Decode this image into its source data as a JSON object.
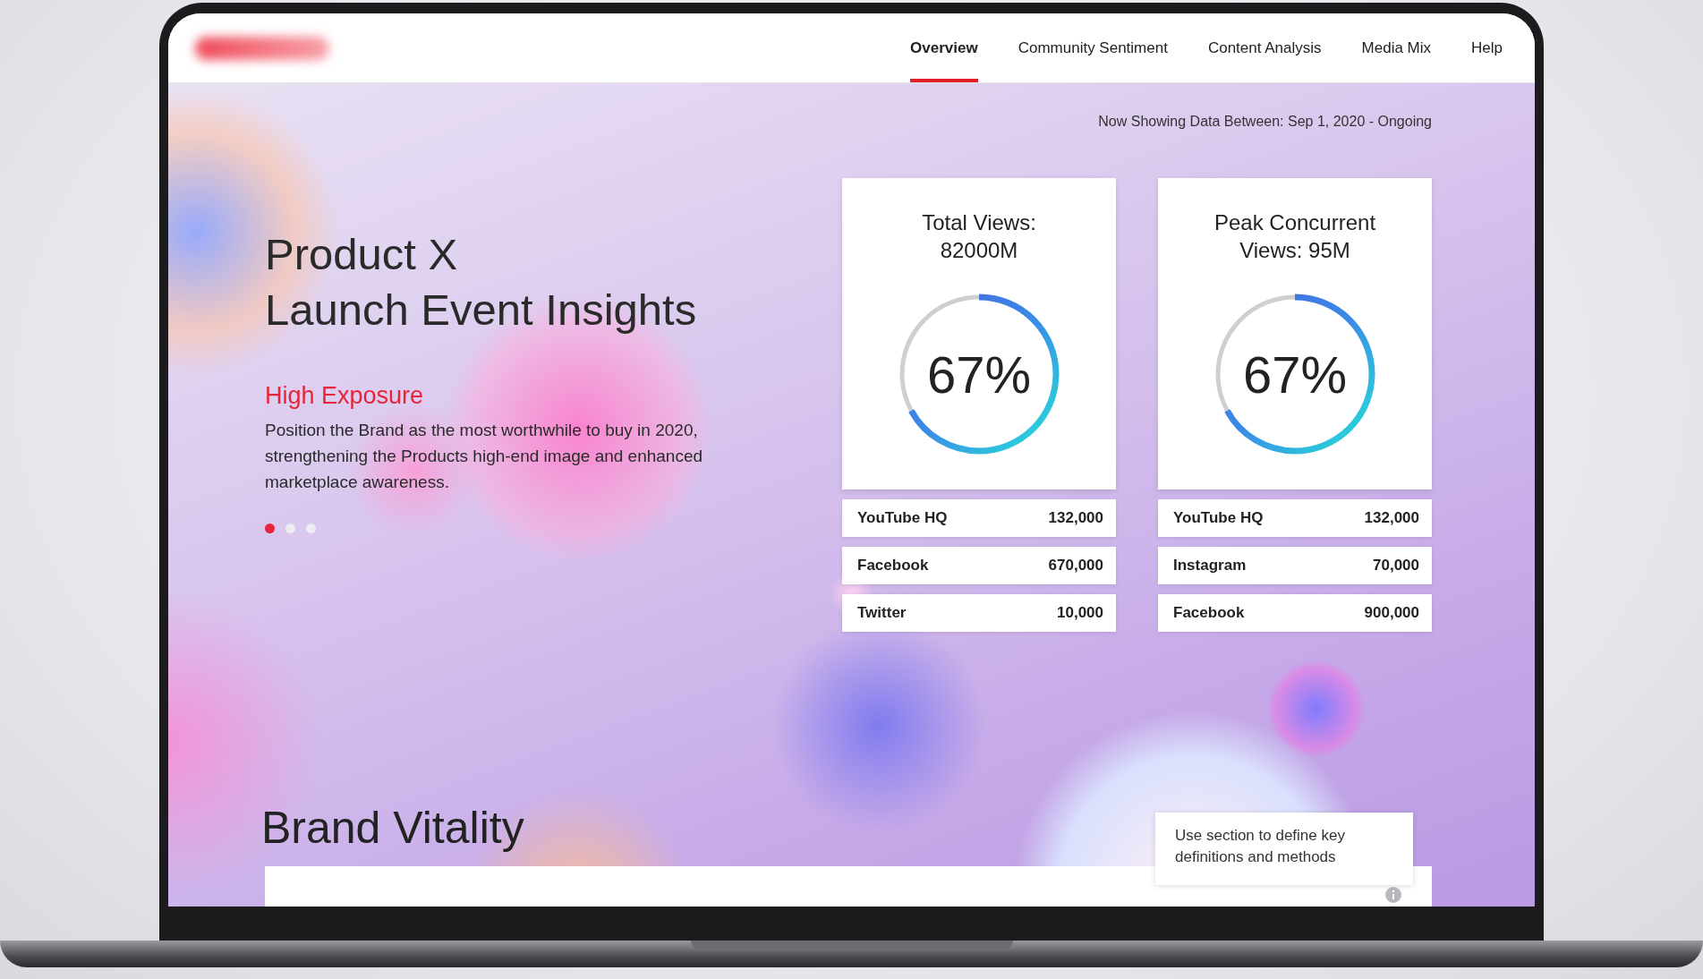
{
  "nav": {
    "items": [
      {
        "label": "Overview",
        "selected": true
      },
      {
        "label": "Community Sentiment",
        "selected": false
      },
      {
        "label": "Content Analysis",
        "selected": false
      },
      {
        "label": "Media Mix",
        "selected": false
      },
      {
        "label": "Help",
        "selected": false
      }
    ]
  },
  "date_range": "Now Showing Data Between: Sep 1, 2020 - Ongoing",
  "hero": {
    "title_lines": [
      "Product X",
      "Launch Event Insights"
    ],
    "subtitle": "High Exposure",
    "text": "Position the Brand as the most worthwhile to buy in 2020, strengthening the Products high-end image and enhanced marketplace awareness.",
    "dots": [
      {
        "selected": true
      },
      {
        "selected": false
      },
      {
        "selected": false
      }
    ]
  },
  "cards": [
    {
      "title": "Total Views: 82000M",
      "level": 0.67,
      "reading": "67%",
      "rows": [
        {
          "name": "YouTube HQ",
          "value": "132,000"
        },
        {
          "name": "Facebook",
          "value": "670,000"
        },
        {
          "name": "Twitter",
          "value": "10,000"
        }
      ]
    },
    {
      "title": "Peak Concurrent Views: 95M",
      "level": 0.67,
      "reading": "67%",
      "rows": [
        {
          "name": "YouTube HQ",
          "value": "132,000"
        },
        {
          "name": "Instagram",
          "value": "70,000"
        },
        {
          "name": "Facebook",
          "value": "900,000"
        }
      ]
    }
  ],
  "brand_section": {
    "title": "Brand Vitality",
    "tooltip": "Use section to define key definitions and methods"
  }
}
